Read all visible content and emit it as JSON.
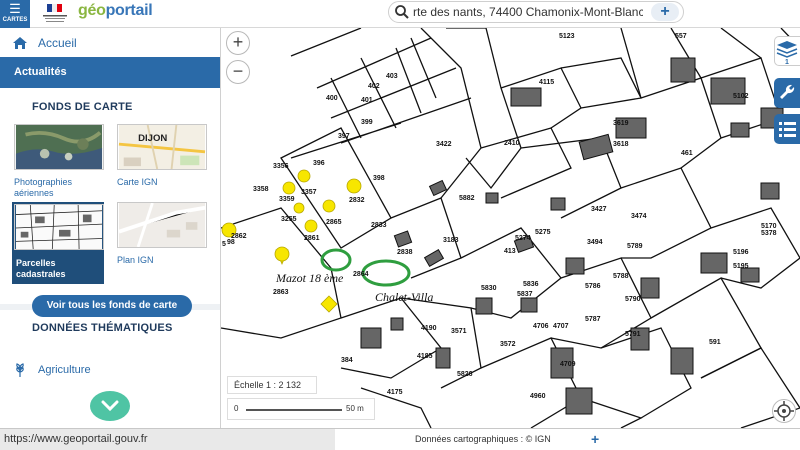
{
  "header": {
    "cartes_label": "CARTES",
    "brand_prefix": "g",
    "brand_middle": "éo",
    "brand_suffix": "portail",
    "search_value": "rte des nants, 74400 Chamonix-Mont-Blanc",
    "search_add": "+"
  },
  "sidebar": {
    "home_label": "Accueil",
    "actualites_label": "Actualités",
    "fonds_title": "FONDS DE CARTE",
    "fonds": [
      {
        "label": "Photographies aériennes"
      },
      {
        "label": "Carte IGN"
      },
      {
        "label": "Parcelles cadastrales"
      },
      {
        "label": "Plan IGN"
      }
    ],
    "carte_ign_thumb_text": "DIJON",
    "voir_tous_label": "Voir tous les fonds de carte",
    "themes_title": "DONNÉES THÉMATIQUES",
    "themes": [
      {
        "label": "Agriculture"
      }
    ]
  },
  "map": {
    "zoom_in": "+",
    "zoom_out": "−",
    "scale_label": "Échelle 1 : 2 132",
    "scale_start": "0",
    "scale_end": "50 m",
    "layer_count": "1",
    "annotations": [
      {
        "text": "Mazot 18 ème"
      },
      {
        "text": "Chalet-Villa"
      }
    ],
    "parcel_numbers": [
      "403",
      "402",
      "400",
      "401",
      "399",
      "397",
      "396",
      "398",
      "3356",
      "3357",
      "3358",
      "3359",
      "3255",
      "2865",
      "2861",
      "2832",
      "2862",
      "2833",
      "2863",
      "384",
      "3422",
      "2410",
      "5882",
      "5123",
      "557",
      "4115",
      "3618",
      "3619",
      "5102",
      "461",
      "3474",
      "3427",
      "5274",
      "413",
      "5275",
      "3494",
      "5789",
      "5196",
      "5170",
      "5378",
      "5195",
      "5788",
      "5786",
      "5787",
      "5790",
      "5791",
      "4706",
      "4707",
      "4709",
      "4960",
      "5826",
      "3571",
      "3572",
      "5837",
      "5836",
      "5830",
      "4190",
      "4185",
      "4175",
      "2864",
      "3183",
      "591",
      "5",
      "98",
      "2838"
    ]
  },
  "footer": {
    "url": "https://www.geoportail.gouv.fr",
    "attribution": "Données cartographiques : ©  IGN",
    "attribution_plus": "+"
  },
  "colors": {
    "primary": "#2a6aa8",
    "accent_green": "#8ab641",
    "teal": "#4fc4a4",
    "marker_yellow": "#f7e600",
    "annotation_green": "#2f9e3f"
  }
}
